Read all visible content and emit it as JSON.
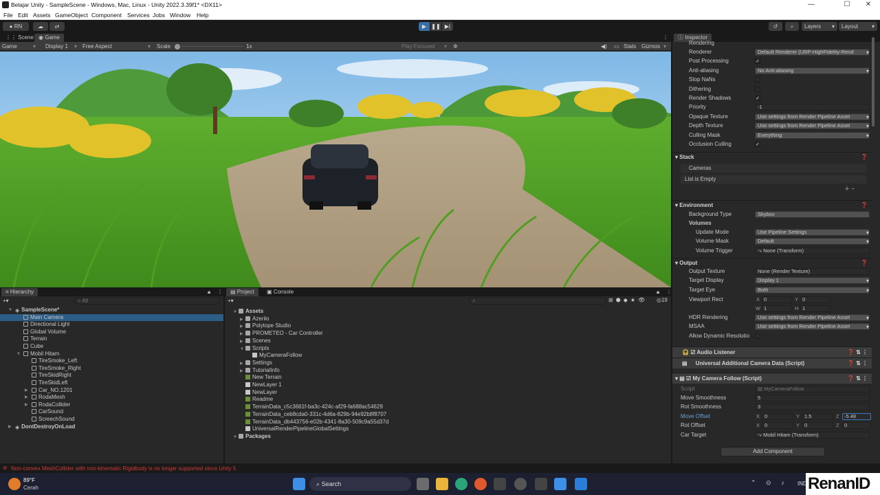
{
  "window": {
    "title": "Belajar Unity - SampleScene - Windows, Mac, Linux - Unity 2022.3.39f1* <DX11>"
  },
  "menu": [
    "File",
    "Edit",
    "Assets",
    "GameObject",
    "Component",
    "Services",
    "Jobs",
    "Window",
    "Help"
  ],
  "toolbar": {
    "account": "RN",
    "layers": "Layers",
    "layout": "Layout"
  },
  "game_panel": {
    "tabs": [
      "Scene",
      "Game"
    ],
    "mode": "Game",
    "display": "Display 1",
    "aspect": "Free Aspect",
    "scale_label": "Scale",
    "scale_value": "1x",
    "play_focused": "Play Focused",
    "stats": "Stats",
    "gizmos": "Gizmos"
  },
  "hierarchy": {
    "tab": "Hierarchy",
    "search_placeholder": "All",
    "items": [
      {
        "label": "SampleScene*",
        "indent": 0,
        "kind": "scene"
      },
      {
        "label": "Main Camera",
        "indent": 1,
        "kind": "obj",
        "selected": true
      },
      {
        "label": "Directional Light",
        "indent": 1,
        "kind": "obj"
      },
      {
        "label": "Global Volume",
        "indent": 1,
        "kind": "obj"
      },
      {
        "label": "Terrain",
        "indent": 1,
        "kind": "obj"
      },
      {
        "label": "Cube",
        "indent": 1,
        "kind": "obj"
      },
      {
        "label": "Mobil Hitam",
        "indent": 1,
        "kind": "obj",
        "expanded": true
      },
      {
        "label": "TireSmoke_Left",
        "indent": 2,
        "kind": "obj"
      },
      {
        "label": "TireSmoke_Right",
        "indent": 2,
        "kind": "obj"
      },
      {
        "label": "TireSkidRight",
        "indent": 2,
        "kind": "obj"
      },
      {
        "label": "TireSkidLeft",
        "indent": 2,
        "kind": "obj"
      },
      {
        "label": "Car_NO.1201",
        "indent": 2,
        "kind": "obj",
        "collapsed": true
      },
      {
        "label": "RodaMesh",
        "indent": 2,
        "kind": "obj",
        "collapsed": true
      },
      {
        "label": "RodaCollider",
        "indent": 2,
        "kind": "obj",
        "collapsed": true
      },
      {
        "label": "CarSound",
        "indent": 2,
        "kind": "obj"
      },
      {
        "label": "ScreechSound",
        "indent": 2,
        "kind": "obj"
      },
      {
        "label": "DontDestroyOnLoad",
        "indent": 0,
        "kind": "scene",
        "collapsed": true
      }
    ]
  },
  "project": {
    "tabs": [
      "Project",
      "Console"
    ],
    "count": "19",
    "items": [
      {
        "label": "Assets",
        "indent": 0,
        "kind": "folder",
        "bold": true
      },
      {
        "label": "Azerilo",
        "indent": 1,
        "kind": "folder"
      },
      {
        "label": "Polytope Studio",
        "indent": 1,
        "kind": "folder"
      },
      {
        "label": "PROMETEO - Car Controller",
        "indent": 1,
        "kind": "folder"
      },
      {
        "label": "Scenes",
        "indent": 1,
        "kind": "folder"
      },
      {
        "label": "Scripts",
        "indent": 1,
        "kind": "folder",
        "expanded": true
      },
      {
        "label": "MyCameraFollow",
        "indent": 2,
        "kind": "script"
      },
      {
        "label": "Settings",
        "indent": 1,
        "kind": "folder"
      },
      {
        "label": "TutorialInfo",
        "indent": 1,
        "kind": "folder"
      },
      {
        "label": "New Terrain",
        "indent": 1,
        "kind": "file"
      },
      {
        "label": "NewLayer 1",
        "indent": 1,
        "kind": "doc"
      },
      {
        "label": "NewLayer",
        "indent": 1,
        "kind": "doc"
      },
      {
        "label": "Readme",
        "indent": 1,
        "kind": "file"
      },
      {
        "label": "TerrainData_c5c3661f-ba3c-424c-af29-fa688ac54629",
        "indent": 1,
        "kind": "file"
      },
      {
        "label": "TerrainData_ceb8cda0-331c-4d6a-829b-94e92b8f8707",
        "indent": 1,
        "kind": "file"
      },
      {
        "label": "TerrainData_db443756-e02b-4341-8a30-509c9a55d37d",
        "indent": 1,
        "kind": "file"
      },
      {
        "label": "UniversalRenderPipelineGlobalSettings",
        "indent": 1,
        "kind": "doc"
      },
      {
        "label": "Packages",
        "indent": 0,
        "kind": "folder",
        "bold": true
      }
    ]
  },
  "inspector": {
    "tab": "Inspector",
    "rendering_header": "Rendering",
    "rendering": [
      {
        "label": "Renderer",
        "type": "dd",
        "value": "Default Renderer (URP-HighFidelity-Rend"
      },
      {
        "label": "Post Processing",
        "type": "chk",
        "value": "✓"
      },
      {
        "label": "Anti-aliasing",
        "type": "dd",
        "value": "No Anti-aliasing"
      },
      {
        "label": "Stop NaNs",
        "type": "chk",
        "value": ""
      },
      {
        "label": "Dithering",
        "type": "chk",
        "value": ""
      },
      {
        "label": "Render Shadows",
        "type": "chk",
        "value": "✓"
      },
      {
        "label": "Priority",
        "type": "fld",
        "value": "-1"
      },
      {
        "label": "Opaque Texture",
        "type": "dd",
        "value": "Use settings from Render Pipeline Asset"
      },
      {
        "label": "Depth Texture",
        "type": "dd",
        "value": "Use settings from Render Pipeline Asset"
      },
      {
        "label": "Culling Mask",
        "type": "dd",
        "value": "Everything"
      },
      {
        "label": "Occlusion Culling",
        "type": "chk",
        "value": "✓"
      }
    ],
    "stack_header": "Stack",
    "stack_cameras": "Cameras",
    "stack_empty": "List is Empty",
    "env_header": "Environment",
    "background_type_label": "Background Type",
    "background_type": "Skybox",
    "volumes_label": "Volumes",
    "volumes": [
      {
        "label": "Update Mode",
        "type": "dd",
        "value": "Use Pipeline Settings"
      },
      {
        "label": "Volume Mask",
        "type": "dd",
        "value": "Default"
      },
      {
        "label": "Volume Trigger",
        "type": "fld",
        "value": "⤳ None (Transform)"
      }
    ],
    "output_header": "Output",
    "output": [
      {
        "label": "Output Texture",
        "type": "fld",
        "value": "None (Render Texture)"
      },
      {
        "label": "Target Display",
        "type": "dd",
        "value": "Display 1"
      },
      {
        "label": "Target Eye",
        "type": "dd",
        "value": "Both"
      }
    ],
    "viewport_label": "Viewport Rect",
    "viewport": {
      "x": "0",
      "y": "0",
      "w": "1",
      "h": "1"
    },
    "output2": [
      {
        "label": "HDR Rendering",
        "type": "dd",
        "value": "Use settings from Render Pipeline Asset"
      },
      {
        "label": "MSAA",
        "type": "dd",
        "value": "Use settings from Render Pipeline Asset"
      },
      {
        "label": "Allow Dynamic Resolutio",
        "type": "chk",
        "value": ""
      }
    ],
    "audio_listener": "Audio Listener",
    "uacd": "Universal Additional Camera Data (Script)",
    "mcf": "My Camera Follow (Script)",
    "mcf_script_label": "Script",
    "mcf_script_value": "MyCameraFollow",
    "move_smoothness_label": "Move Smoothness",
    "move_smoothness": "5",
    "rot_smoothness_label": "Rot Smoothness",
    "rot_smoothness": "3",
    "move_offset_label": "Move Offset",
    "move_offset": {
      "x": "0",
      "y": "1.5",
      "z": "-5.48"
    },
    "rot_offset_label": "Rot Offset",
    "rot_offset": {
      "x": "0",
      "y": "0",
      "z": "0"
    },
    "car_target_label": "Car Target",
    "car_target": "⤳ Mobil Hitam (Transform)",
    "add_component": "Add Component"
  },
  "status_bar": {
    "message": "Non-convex MeshCollider with non-kinematic Rigidbody is no longer supported since Unity 5"
  },
  "taskbar": {
    "temp": "89°F",
    "weather": "Cerah",
    "search": "Search",
    "lang": "IND"
  },
  "watermark": "RenanID",
  "colors": {
    "accent": "#2c5d87",
    "error": "#d03a3a",
    "panel": "#282828"
  }
}
